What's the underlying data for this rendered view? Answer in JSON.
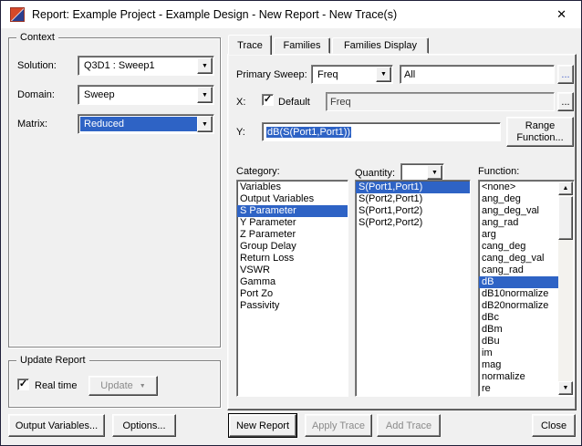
{
  "colors": {
    "selection": "#2e63c5",
    "window": "#f0f0f0",
    "titlebar": "#ffffff",
    "frame": "#20203a",
    "disabled": "#8a8a8a"
  },
  "glyphs": {
    "close": "✕",
    "dropdown": "▼",
    "up": "▲",
    "check": "✓",
    "more": "..."
  },
  "window": {
    "title": "Report: Example Project - Example Design - New Report - New Trace(s)"
  },
  "context": {
    "legend": "Context",
    "solution_label": "Solution:",
    "solution_value": "Q3D1 : Sweep1",
    "domain_label": "Domain:",
    "domain_value": "Sweep",
    "matrix_label": "Matrix:",
    "matrix_value": "Reduced"
  },
  "update_report": {
    "legend": "Update Report",
    "real_time_label": "Real time",
    "update_button_label": "Update"
  },
  "tabs": [
    {
      "label": "Trace"
    },
    {
      "label": "Families"
    },
    {
      "label": "Families Display"
    }
  ],
  "trace_tab": {
    "primary_sweep_label": "Primary Sweep:",
    "primary_sweep_value": "Freq",
    "sweep_range_value": "All",
    "x_label": "X:",
    "x_default_label": "Default",
    "x_value": "Freq",
    "y_label": "Y:",
    "y_value": "dB(S(Port1,Port1))",
    "range_function_label": "Range Function...",
    "category": {
      "label": "Category:",
      "selected": "S Parameter",
      "items": [
        "Variables",
        "Output Variables",
        "S Parameter",
        "Y Parameter",
        "Z Parameter",
        "Group Delay",
        "Return Loss",
        "VSWR",
        "Gamma",
        "Port Zo",
        "Passivity"
      ]
    },
    "quantity": {
      "label": "Quantity:",
      "combo_value": "",
      "selected": "S(Port1,Port1)",
      "items": [
        "S(Port1,Port1)",
        "S(Port2,Port1)",
        "S(Port1,Port2)",
        "S(Port2,Port2)"
      ]
    },
    "function": {
      "label": "Function:",
      "selected": "dB",
      "items": [
        "<none>",
        "ang_deg",
        "ang_deg_val",
        "ang_rad",
        "arg",
        "cang_deg",
        "cang_deg_val",
        "cang_rad",
        "dB",
        "dB10normalize",
        "dB20normalize",
        "dBc",
        "dBm",
        "dBu",
        "im",
        "mag",
        "normalize",
        "re"
      ]
    }
  },
  "footer": {
    "output_variables_label": "Output Variables...",
    "options_label": "Options...",
    "new_report_label": "New Report",
    "apply_trace_label": "Apply Trace",
    "add_trace_label": "Add Trace",
    "close_label": "Close"
  }
}
